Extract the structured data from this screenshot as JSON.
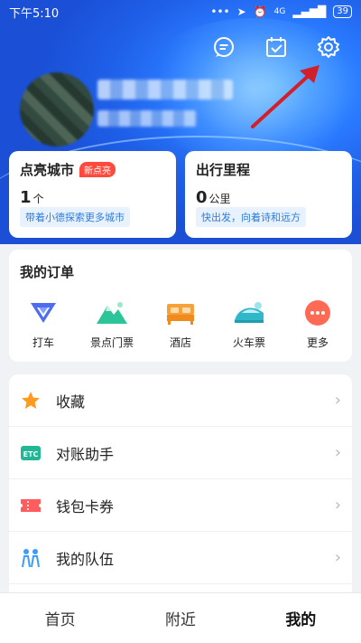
{
  "status_bar": {
    "time": "下午5:10",
    "network": "4G",
    "battery": "39"
  },
  "orders": {
    "title": "我的订单",
    "items": [
      {
        "label": "打车",
        "icon": "taxi-icon"
      },
      {
        "label": "景点门票",
        "icon": "mountain-ticket-icon"
      },
      {
        "label": "酒店",
        "icon": "hotel-bed-icon"
      },
      {
        "label": "火车票",
        "icon": "train-icon"
      },
      {
        "label": "更多",
        "icon": "more-icon"
      }
    ]
  },
  "stats": {
    "cities": {
      "title": "点亮城市",
      "badge": "新点亮",
      "value": "1",
      "unit": "个",
      "tip": "带着小德探索更多城市"
    },
    "mileage": {
      "title": "出行里程",
      "value": "0",
      "unit": "公里",
      "tip": "快出发，向着诗和远方"
    }
  },
  "menu": [
    {
      "label": "收藏",
      "icon": "star-icon"
    },
    {
      "label": "对账助手",
      "icon": "etc-icon"
    },
    {
      "label": "钱包卡券",
      "icon": "ticket-icon"
    },
    {
      "label": "我的队伍",
      "icon": "team-icon"
    }
  ],
  "tabs": [
    {
      "label": "首页"
    },
    {
      "label": "附近"
    },
    {
      "label": "我的"
    }
  ],
  "colors": {
    "accent_blue": "#2a7bff",
    "badge_red": "#ff4a3d",
    "tip_blue": "#2f7bd6"
  }
}
